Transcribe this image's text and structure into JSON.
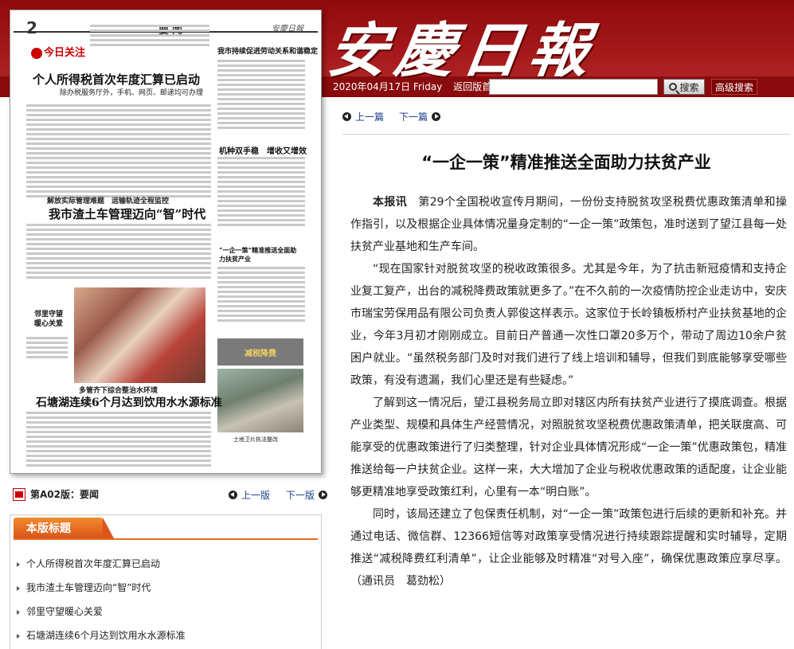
{
  "header": {
    "masthead": "安慶日報",
    "date": "2020年04月17日",
    "weekday": "Friday",
    "back_label": "返回版首",
    "search_placeholder": "",
    "search_label": "搜索",
    "advanced_search_label": "高级搜索"
  },
  "page_image": {
    "page_number": "2",
    "section": "要闻",
    "paper_logo": "安慶日報",
    "focus_label": "今日关注",
    "headline1": "个人所得税首次年度汇算已启动",
    "subhead1": "除办税服务厅外，手机、网页、邮递均可办理",
    "side_headline": "我市持续促进劳动关系和谐稳定",
    "subhead2": "解放实际管理难题　运输轨迹全程监控",
    "headline2": "我市渣土车管理迈向“智”时代",
    "side_title2": "机种双手稳　增收又增效",
    "side_title3": "“一企一策”精准推送全面助力扶贫产业",
    "side_caption": "邻里守望暖心关爱",
    "subhead3": "多管齐下综合整治水环境",
    "headline3": "石塘湖连续6个月达到饮用水水源标准",
    "banner": "减税降费",
    "photo_caption": "土地卫片执法整改"
  },
  "page_nav": {
    "edition": "第A02版：要闻",
    "prev": "上一版",
    "next": "下一版"
  },
  "headline_list": {
    "title": "本版标题",
    "items": [
      "个人所得税首次年度汇算已启动",
      "我市渣土车管理迈向“智”时代",
      "邻里守望暖心关爱",
      "石塘湖连续6个月达到饮用水水源标准"
    ]
  },
  "article_nav": {
    "prev": "上一篇",
    "next": "下一篇"
  },
  "article": {
    "title": "“一企一策”精准推送全面助力扶贫产业",
    "lead": "本报讯",
    "paragraphs": [
      "第29个全国税收宣传月期间，一份份支持脱贫攻坚税费优惠政策清单和操作指引，以及根据企业具体情况量身定制的“一企一策”政策包，准时送到了望江县每一处扶贫产业基地和生产车间。",
      "“现在国家针对脱贫攻坚的税收政策很多。尤其是今年，为了抗击新冠疫情和支持企业复工复产，出台的减税降费政策就更多了。”在不久前的一次疫情防控企业走访中，安庆市瑞宝劳保用品有限公司负责人郭俊这样表示。这家位于长岭镇板桥村产业扶贫基地的企业，今年3月初才刚刚成立。目前日产普通一次性口罩20多万个，带动了周边10余户贫困户就业。“虽然税务部门及时对我们进行了线上培训和辅导，但我们到底能够享受哪些政策，有没有遗漏，我们心里还是有些疑虑。”",
      "了解到这一情况后，望江县税务局立即对辖区内所有扶贫产业进行了摸底调查。根据产业类型、规模和具体生产经营情况，对照脱贫攻坚税费优惠政策清单，把关联度高、可能享受的优惠政策进行了归类整理，针对企业具体情况形成“一企一策”优惠政策包，精准推送给每一户扶贫企业。这样一来，大大增加了企业与税收优惠政策的适配度，让企业能够更精准地享受政策红利，心里有一本“明白账”。",
      "同时，该局还建立了包保责任机制，对“一企一策”政策包进行后续的更新和补充。并通过电话、微信群、12366短信等对政策享受情况进行持续跟踪提醒和实时辅导，定期推送“减税降费红利清单”，让企业能够及时精准“对号入座”，确保优惠政策应享尽享。（通讯员　葛劲松）"
    ]
  }
}
